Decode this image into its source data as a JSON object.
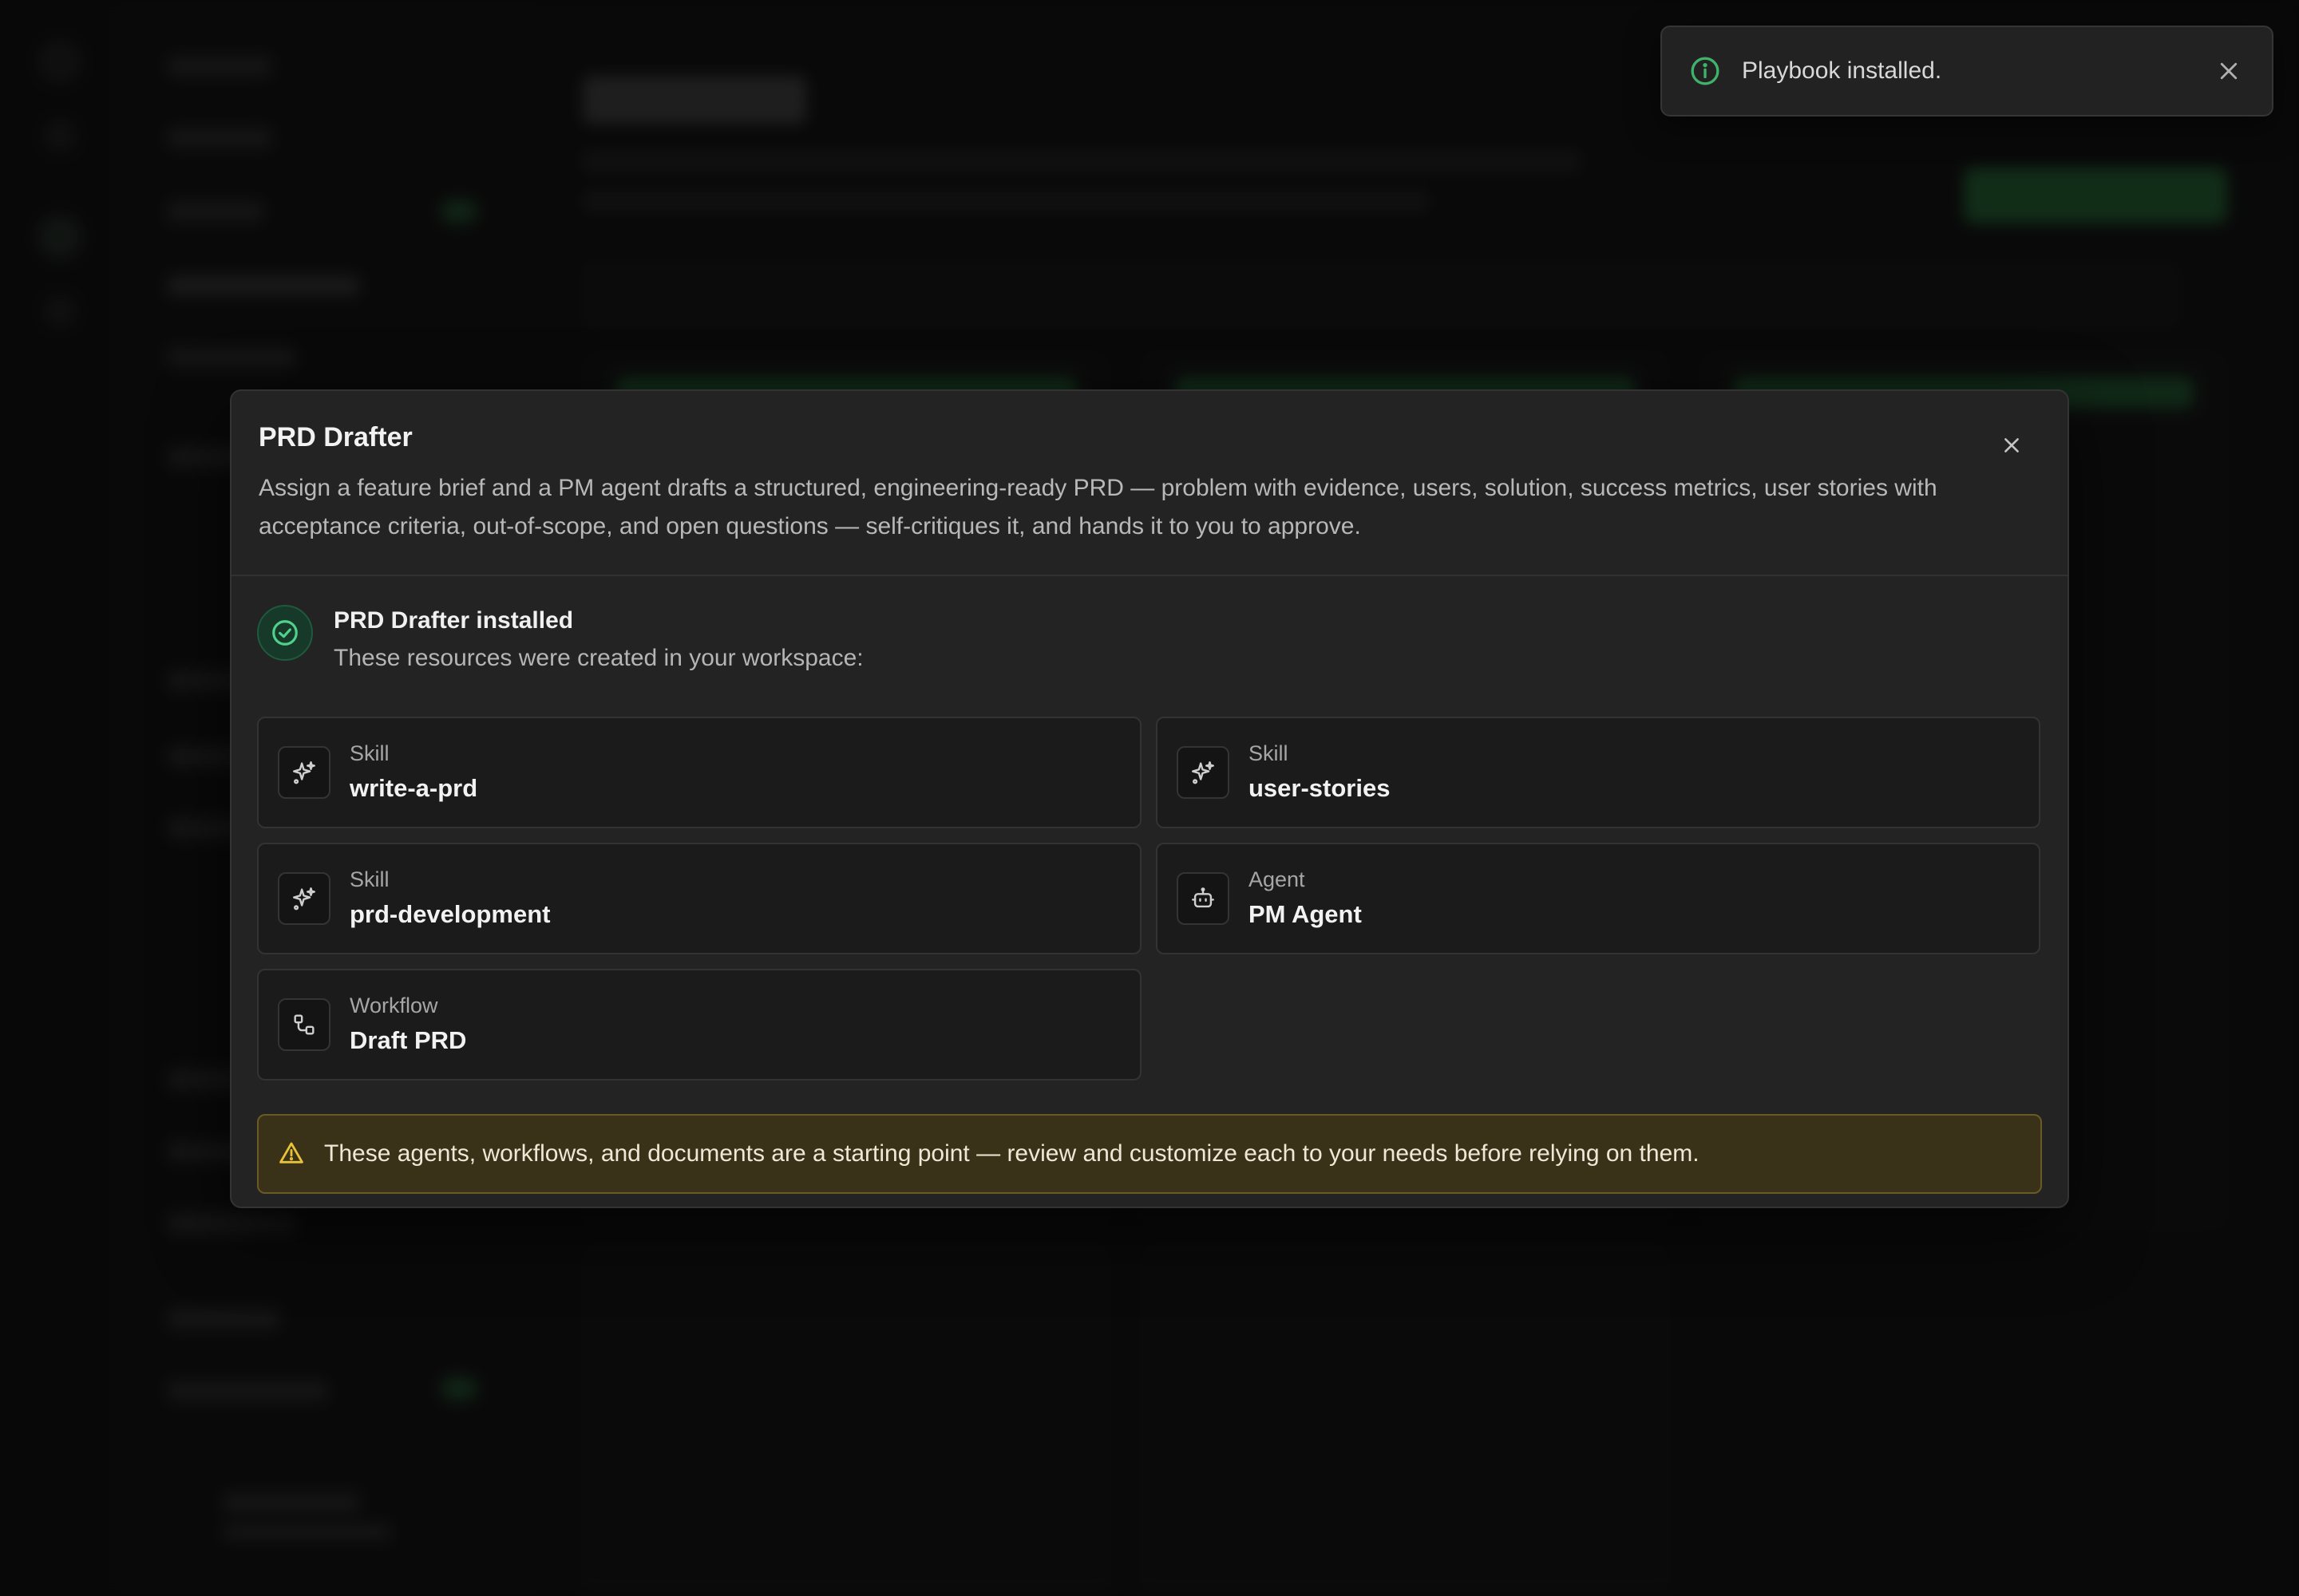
{
  "toast": {
    "message": "Playbook installed.",
    "icon": "info-icon",
    "close_icon": "close-icon",
    "accent_color": "#3fb36a"
  },
  "modal": {
    "title": "PRD Drafter",
    "description": "Assign a feature brief and a PM agent drafts a structured, engineering-ready PRD — problem with evidence, users, solution, success metrics, user stories with acceptance criteria, out-of-scope, and open questions — self-critiques it, and hands it to you to approve.",
    "close_icon": "close-icon",
    "installed": {
      "title": "PRD Drafter installed",
      "subtitle": "These resources were created in your workspace:",
      "icon": "check-circle-icon",
      "accent_color": "#4fd18b"
    },
    "resources": [
      {
        "kind": "Skill",
        "name": "write-a-prd",
        "icon": "sparkles-icon"
      },
      {
        "kind": "Skill",
        "name": "user-stories",
        "icon": "sparkles-icon"
      },
      {
        "kind": "Skill",
        "name": "prd-development",
        "icon": "sparkles-icon"
      },
      {
        "kind": "Agent",
        "name": "PM Agent",
        "icon": "robot-icon"
      },
      {
        "kind": "Workflow",
        "name": "Draft PRD",
        "icon": "workflow-icon"
      }
    ],
    "warning": {
      "text": "These agents, workflows, and documents are a starting point — review and customize each to your needs before relying on them.",
      "icon": "warning-triangle-icon",
      "color": "#e8c33a"
    }
  }
}
